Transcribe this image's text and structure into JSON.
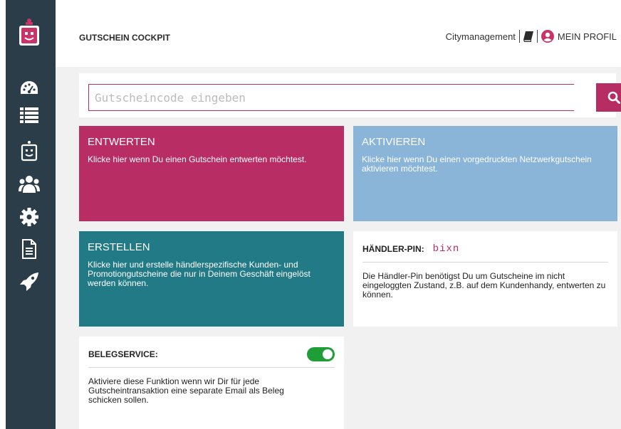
{
  "header": {
    "title": "GUTSCHEIN COCKPIT",
    "org_link": "Citymanagement",
    "profile_label": "MEIN PROFIL"
  },
  "sidebar": {
    "logo_icon": "voucher-robot-logo-icon",
    "items": [
      {
        "icon": "dashboard-icon"
      },
      {
        "icon": "list-icon"
      },
      {
        "icon": "voucher-icon"
      },
      {
        "icon": "users-icon"
      },
      {
        "icon": "gear-icon"
      },
      {
        "icon": "document-icon"
      },
      {
        "icon": "rocket-icon"
      }
    ]
  },
  "search": {
    "placeholder": "Gutscheincode eingeben",
    "value": "",
    "button_icon": "search-icon"
  },
  "tiles": {
    "entwerten": {
      "title": "ENTWERTEN",
      "text": "Klicke hier wenn Du einen Gutschein entwerten möchtest."
    },
    "aktivieren": {
      "title": "AKTIVIEREN",
      "text": "Klicke hier wenn Du einen vorgedruckten Netzwerkgutschein aktivieren möchtest."
    },
    "erstellen": {
      "title": "ERSTELLEN",
      "text": "Klicke hier und erstelle händlerspezifische Kunden- und Promotiongutscheine die nur in Deinem Geschäft eingelöst werden können."
    }
  },
  "pin_card": {
    "label": "HÄNDLER-PIN:",
    "value": "bixn",
    "text": "Die Händler-Pin benötigst Du um Gutscheine im nicht eingeloggten Zustand, z.B. auf dem Kundenhandy, entwerten zu können."
  },
  "beleg_card": {
    "label": "BELEGSERVICE:",
    "enabled": true,
    "text": "Aktiviere diese Funktion wenn wir Dir für jede Gutscheintransaktion eine separate Email als Beleg schicken sollen."
  },
  "colors": {
    "sidebar": "#2b3d49",
    "accent": "#b62d64",
    "tile_entwerten": "#b82d63",
    "tile_aktivieren": "#8ab5d8",
    "tile_erstellen": "#217a85",
    "toggle_on": "#1f9d37",
    "content_bg": "#f1f1f1"
  }
}
